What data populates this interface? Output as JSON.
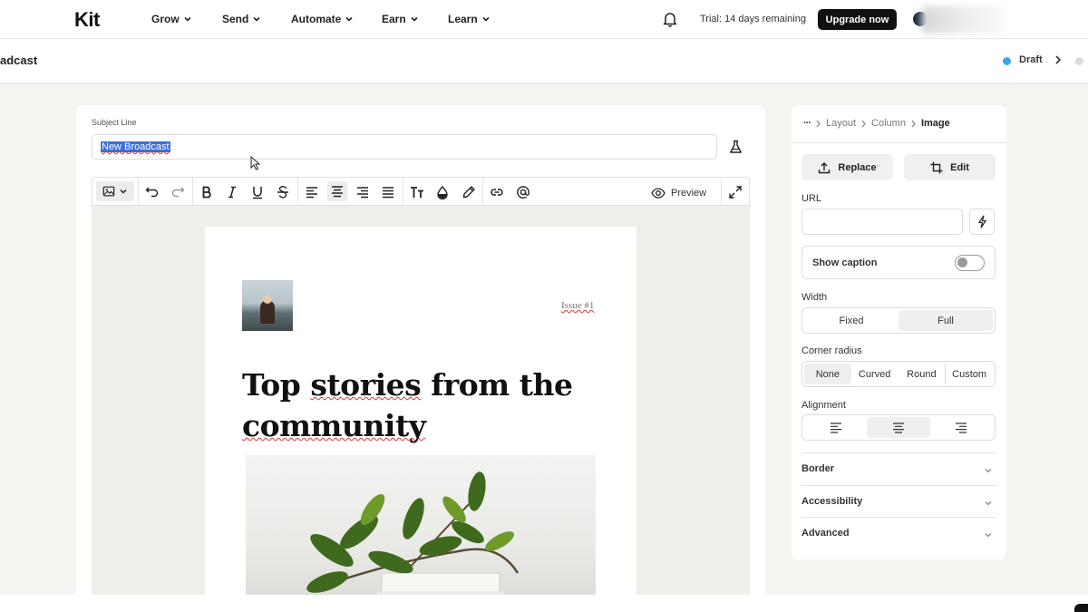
{
  "topnav": {
    "logo": "Kit",
    "items": [
      {
        "label": "Grow"
      },
      {
        "label": "Send"
      },
      {
        "label": "Automate"
      },
      {
        "label": "Earn"
      },
      {
        "label": "Learn"
      }
    ],
    "trial_text": "Trial: 14 days remaining",
    "upgrade_label": "Upgrade now"
  },
  "subheader": {
    "title": "adcast",
    "status": "Draft",
    "status_color": "#3aa8e8"
  },
  "editor": {
    "subject_label": "Subject Line",
    "subject_value": "New Broadcast",
    "toolbar": {
      "preview_label": "Preview",
      "icons": [
        "image-icon",
        "undo-icon",
        "redo-icon",
        "bold-icon",
        "italic-icon",
        "underline-icon",
        "strikethrough-icon",
        "align-left-icon",
        "align-center-icon",
        "align-right-icon",
        "align-justify-icon",
        "text-size-icon",
        "color-drop-icon",
        "highlighter-icon",
        "link-icon",
        "mention-icon",
        "expand-icon"
      ]
    },
    "email": {
      "issue_label": "Issue #1",
      "headline_words": [
        "Top",
        "stories",
        "from",
        "the",
        "community"
      ]
    }
  },
  "panel": {
    "breadcrumb": {
      "more": "···",
      "items": [
        "Layout",
        "Column"
      ],
      "current": "Image"
    },
    "replace_label": "Replace",
    "edit_label": "Edit",
    "url_label": "URL",
    "url_value": "",
    "show_caption_label": "Show caption",
    "show_caption_on": false,
    "width": {
      "label": "Width",
      "options": [
        "Fixed",
        "Full"
      ],
      "selected": "Full"
    },
    "corner_radius": {
      "label": "Corner radius",
      "options": [
        "None",
        "Curved",
        "Round",
        "Custom"
      ],
      "selected": "None"
    },
    "alignment": {
      "label": "Alignment",
      "options": [
        "left",
        "center",
        "right"
      ],
      "selected": "center"
    },
    "sections": [
      "Border",
      "Accessibility",
      "Advanced"
    ]
  }
}
